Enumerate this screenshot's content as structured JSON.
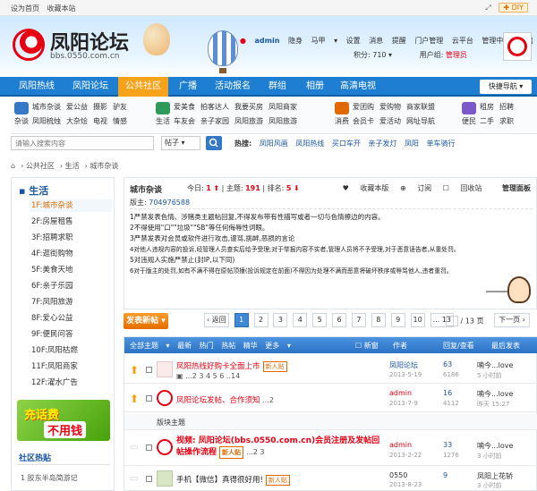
{
  "topbar": {
    "set_home": "设为首页",
    "bookmark": "收藏本站",
    "diy": "DIY"
  },
  "logo": {
    "name": "凤阳论坛",
    "domain": "bbs.0550.com.cn"
  },
  "user": {
    "name": "admin",
    "status": "隐身",
    "horse": "马甲",
    "links": [
      "设置",
      "消息",
      "提醒",
      "门户管理",
      "云平台",
      "管理中心",
      "退出"
    ],
    "points_label": "积分: 710",
    "group_label": "用户组:",
    "group": "管理员"
  },
  "nav": {
    "items": [
      "凤阳热线",
      "凤阳论坛",
      "公共社区",
      "广播",
      "活动报名",
      "群组",
      "相册",
      "高清电视"
    ],
    "active_index": 2,
    "quick": "快捷导航"
  },
  "subnav": {
    "groups": [
      {
        "label": "杂谈",
        "rows": [
          [
            "城市杂谈",
            "爱公益",
            "摄影",
            "驴友"
          ],
          [
            "凤阳梳烛",
            "大杂烩",
            "电视",
            "情感"
          ]
        ]
      },
      {
        "label": "生活",
        "rows": [
          [
            "爱美食",
            "拍客达人",
            "我要买房",
            "凤阳商家"
          ],
          [
            "车友会",
            "亲子家园",
            "凤阳旅游",
            "凤阳旅游"
          ]
        ]
      },
      {
        "label": "消费",
        "rows": [
          [
            "爱团购",
            "爱购物",
            "商家联盟"
          ],
          [
            "会员卡",
            "爱活动",
            "网址导航"
          ]
        ]
      },
      {
        "label": "便民",
        "rows": [
          [
            "租房",
            "招聘"
          ],
          [
            "二手",
            "求职"
          ]
        ]
      }
    ]
  },
  "search": {
    "placeholder": "请输入搜索内容",
    "scope": "帖子",
    "hot_label": "热搜:",
    "hot": [
      "凤阳风画",
      "凤阳热线",
      "买口车开",
      "亲子发灯",
      "凤阳",
      "单车骑行"
    ]
  },
  "breadcrumb": [
    "公共社区",
    "生活",
    "城市杂谈"
  ],
  "sidebar": {
    "title": "生活",
    "items": [
      "1F:城市杂谈",
      "2F:房屋租售",
      "3F:招聘求职",
      "4F:逛街购物",
      "5F:美食天地",
      "6F:亲子乐园",
      "7F:凤阳旅游",
      "8F:爱心公益",
      "9F:便民问答",
      "10F:凤阳枯燃",
      "11F:凤阳商家",
      "12F:濯水广告"
    ],
    "active_index": 0,
    "ad_text1": "充话费",
    "ad_text2": "不用钱",
    "hot_title": "社区热贴",
    "hot_first": "1   胶东半岛简游记"
  },
  "forum": {
    "title": "城市杂谈",
    "today_label": "今日:",
    "today": "1",
    "topics_label": "主题:",
    "topics": "191",
    "rank_label": "排名:",
    "rank": "5",
    "tools": [
      "收藏本版",
      "订阅",
      "回收站",
      "管理面板"
    ],
    "mod_label": "版主:",
    "mod": "704976588",
    "rules": [
      "1严禁发表色情、涉赌类主题帖回复,不得发布带有性描写或者一切与色情擦边的内容。",
      "2不得使用\"口\"\"垃圾\"\"SB\"等任何侮辱性词眼。",
      "3严禁发表对会员或软件进行攻击,谩骂,挑衅,恶损的言论",
      "4对他人违规内容的投诉,经管理人员查实后给予受理;对于举报内容不实者,管理人员将不予受理,对于恶意诬告者,从重处罚。",
      "5对违规人实施严禁止(封IP,以下同)",
      "6对于版主的处罚,如有不满不得在原帖顶撞(投诉规定在前面)不得因为处理不满而恶意将破坏秩序或辱骂他人,违者重罚。"
    ]
  },
  "actions": {
    "new_post": "发表新帖",
    "prev": "返回",
    "pages": [
      "1",
      "2",
      "3",
      "4",
      "5",
      "6",
      "7",
      "8",
      "9",
      "10",
      "... 13"
    ],
    "current_page": 0,
    "page_info": "/ 13 页",
    "next": "下一页"
  },
  "list": {
    "head_left": [
      "全部主题",
      "最新",
      "热门",
      "热帖",
      "精华",
      "更多"
    ],
    "head_new": "新窗",
    "head_author": "作者",
    "head_reply": "回复/查看",
    "head_last": "最后发表",
    "rows": [
      {
        "title": "凤阳热线好购卡全面上市",
        "tag": "新人贴",
        "pages": "...2 3 4 5 6 ..14",
        "author": "凤阳论坛",
        "date": "2013-5-19",
        "replies": "63",
        "views": "6186",
        "last": "喃今...love",
        "last_time": "5 小时前"
      },
      {
        "title": "凤阳论坛发帖、合作须知",
        "tag": "",
        "pages": "...2",
        "author": "admin",
        "date": "2013-7-9",
        "replies": "16",
        "views": "4112",
        "last": "喃今...love",
        "last_time": "昨天 15:27"
      },
      {
        "title": "版块主题",
        "tag": "",
        "pages": "",
        "author": "",
        "date": "",
        "replies": "",
        "views": "",
        "last": "",
        "last_time": ""
      },
      {
        "title": "视频: 凤阳论坛(bbs.0550.com.cn)会员注册及发帖回帖操作流程",
        "tag": "新人贴",
        "pages": "...2 3",
        "author": "admin",
        "date": "2013-2-22",
        "replies": "33",
        "views": "1276",
        "last": "喃今...love",
        "last_time": "3 小时前"
      },
      {
        "title": "手机【微信】真得很好用!",
        "tag": "新人贴",
        "pages": "",
        "author": "0550",
        "date": "2013-8-23",
        "replies": "9",
        "views": "",
        "last": "凤阳上花轿",
        "last_time": "3 小时前"
      }
    ]
  },
  "colors": {
    "nav": "#1e7fd2",
    "active": "#f7a21b",
    "brand_red": "#e60012",
    "link": "#1a56a5"
  }
}
